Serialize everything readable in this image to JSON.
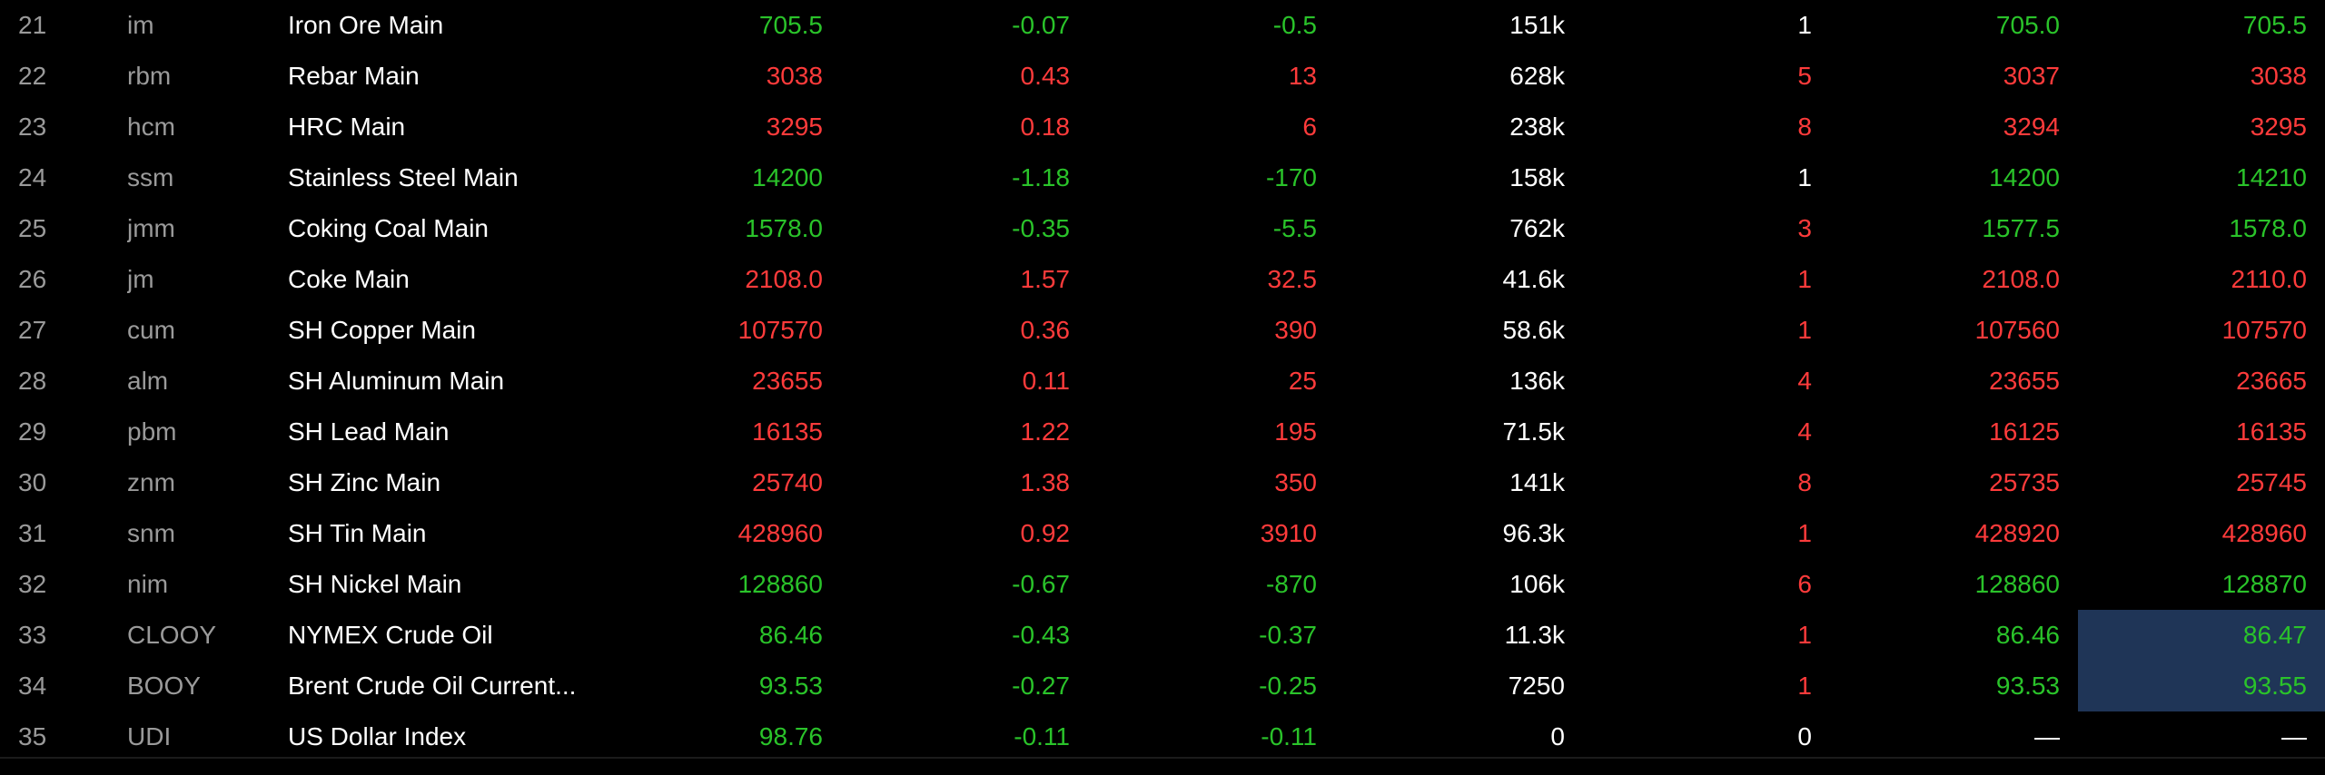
{
  "colors": {
    "up": "#ff3b3b",
    "down": "#2ac32a",
    "flat": "#ffffff",
    "muted": "#9a9a9a",
    "name": "#ffffff",
    "highlight": "#1f3557"
  },
  "rows": [
    {
      "num": "21",
      "code": "im",
      "name": "Iron Ore Main",
      "last": "705.5",
      "pct": "-0.07",
      "chg": "-0.5",
      "vol": "151k",
      "size": "1",
      "bid": "705.0",
      "ask": "705.5",
      "dir": "down",
      "size_dir": "flat",
      "bid_dir": "down",
      "ask_dir": "down",
      "ask_highlight": false
    },
    {
      "num": "22",
      "code": "rbm",
      "name": "Rebar Main",
      "last": "3038",
      "pct": "0.43",
      "chg": "13",
      "vol": "628k",
      "size": "5",
      "bid": "3037",
      "ask": "3038",
      "dir": "up",
      "size_dir": "up",
      "bid_dir": "up",
      "ask_dir": "up",
      "ask_highlight": false
    },
    {
      "num": "23",
      "code": "hcm",
      "name": "HRC Main",
      "last": "3295",
      "pct": "0.18",
      "chg": "6",
      "vol": "238k",
      "size": "8",
      "bid": "3294",
      "ask": "3295",
      "dir": "up",
      "size_dir": "up",
      "bid_dir": "up",
      "ask_dir": "up",
      "ask_highlight": false
    },
    {
      "num": "24",
      "code": "ssm",
      "name": "Stainless Steel Main",
      "last": "14200",
      "pct": "-1.18",
      "chg": "-170",
      "vol": "158k",
      "size": "1",
      "bid": "14200",
      "ask": "14210",
      "dir": "down",
      "size_dir": "flat",
      "bid_dir": "down",
      "ask_dir": "down",
      "ask_highlight": false
    },
    {
      "num": "25",
      "code": "jmm",
      "name": "Coking Coal Main",
      "last": "1578.0",
      "pct": "-0.35",
      "chg": "-5.5",
      "vol": "762k",
      "size": "3",
      "bid": "1577.5",
      "ask": "1578.0",
      "dir": "down",
      "size_dir": "up",
      "bid_dir": "down",
      "ask_dir": "down",
      "ask_highlight": false
    },
    {
      "num": "26",
      "code": "jm",
      "name": "Coke Main",
      "last": "2108.0",
      "pct": "1.57",
      "chg": "32.5",
      "vol": "41.6k",
      "size": "1",
      "bid": "2108.0",
      "ask": "2110.0",
      "dir": "up",
      "size_dir": "up",
      "bid_dir": "up",
      "ask_dir": "up",
      "ask_highlight": false
    },
    {
      "num": "27",
      "code": "cum",
      "name": "SH Copper Main",
      "last": "107570",
      "pct": "0.36",
      "chg": "390",
      "vol": "58.6k",
      "size": "1",
      "bid": "107560",
      "ask": "107570",
      "dir": "up",
      "size_dir": "up",
      "bid_dir": "up",
      "ask_dir": "up",
      "ask_highlight": false
    },
    {
      "num": "28",
      "code": "alm",
      "name": "SH Aluminum Main",
      "last": "23655",
      "pct": "0.11",
      "chg": "25",
      "vol": "136k",
      "size": "4",
      "bid": "23655",
      "ask": "23665",
      "dir": "up",
      "size_dir": "up",
      "bid_dir": "up",
      "ask_dir": "up",
      "ask_highlight": false
    },
    {
      "num": "29",
      "code": "pbm",
      "name": "SH Lead Main",
      "last": "16135",
      "pct": "1.22",
      "chg": "195",
      "vol": "71.5k",
      "size": "4",
      "bid": "16125",
      "ask": "16135",
      "dir": "up",
      "size_dir": "up",
      "bid_dir": "up",
      "ask_dir": "up",
      "ask_highlight": false
    },
    {
      "num": "30",
      "code": "znm",
      "name": "SH Zinc Main",
      "last": "25740",
      "pct": "1.38",
      "chg": "350",
      "vol": "141k",
      "size": "8",
      "bid": "25735",
      "ask": "25745",
      "dir": "up",
      "size_dir": "up",
      "bid_dir": "up",
      "ask_dir": "up",
      "ask_highlight": false
    },
    {
      "num": "31",
      "code": "snm",
      "name": "SH Tin Main",
      "last": "428960",
      "pct": "0.92",
      "chg": "3910",
      "vol": "96.3k",
      "size": "1",
      "bid": "428920",
      "ask": "428960",
      "dir": "up",
      "size_dir": "up",
      "bid_dir": "up",
      "ask_dir": "up",
      "ask_highlight": false
    },
    {
      "num": "32",
      "code": "nim",
      "name": "SH Nickel Main",
      "last": "128860",
      "pct": "-0.67",
      "chg": "-870",
      "vol": "106k",
      "size": "6",
      "bid": "128860",
      "ask": "128870",
      "dir": "down",
      "size_dir": "up",
      "bid_dir": "down",
      "ask_dir": "down",
      "ask_highlight": false
    },
    {
      "num": "33",
      "code": "CLOOY",
      "name": "NYMEX Crude Oil",
      "last": "86.46",
      "pct": "-0.43",
      "chg": "-0.37",
      "vol": "11.3k",
      "size": "1",
      "bid": "86.46",
      "ask": "86.47",
      "dir": "down",
      "size_dir": "up",
      "bid_dir": "down",
      "ask_dir": "down",
      "ask_highlight": true
    },
    {
      "num": "34",
      "code": "BOOY",
      "name": "Brent Crude Oil Current...",
      "last": "93.53",
      "pct": "-0.27",
      "chg": "-0.25",
      "vol": "7250",
      "size": "1",
      "bid": "93.53",
      "ask": "93.55",
      "dir": "down",
      "size_dir": "up",
      "bid_dir": "down",
      "ask_dir": "down",
      "ask_highlight": true
    },
    {
      "num": "35",
      "code": "UDI",
      "name": "US Dollar Index",
      "last": "98.76",
      "pct": "-0.11",
      "chg": "-0.11",
      "vol": "0",
      "size": "0",
      "bid": "—",
      "ask": "—",
      "dir": "down",
      "size_dir": "flat",
      "bid_dir": "flat",
      "ask_dir": "flat",
      "ask_highlight": false
    }
  ]
}
